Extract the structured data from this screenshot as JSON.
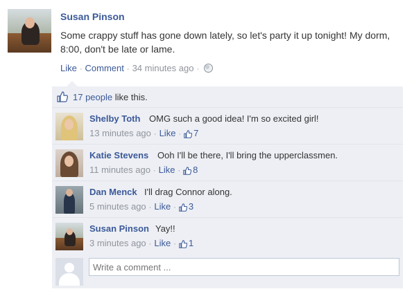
{
  "post": {
    "author": "Susan Pinson",
    "text": "Some crappy stuff has gone down lately, so let's party it up tonight! My dorm, 8:00, don't be late or lame.",
    "like_label": "Like",
    "comment_label": "Comment",
    "timestamp": "34 minutes ago",
    "privacy_icon": "globe-icon"
  },
  "likes": {
    "count_text": "17 people",
    "suffix": " like this.",
    "icon": "thumbs-up-icon"
  },
  "comments": [
    {
      "name": "Shelby Toth",
      "text": "OMG such a good idea! I'm so excited girl!",
      "time": "13 minutes ago",
      "like_label": "Like",
      "likes": "7"
    },
    {
      "name": "Katie Stevens",
      "text": "Ooh I'll be there, I'll bring the upperclassmen.",
      "time": "11 minutes ago",
      "like_label": "Like",
      "likes": "8"
    },
    {
      "name": "Dan Menck",
      "text": "I'll drag Connor along.",
      "time": "5 minutes ago",
      "like_label": "Like",
      "likes": "3"
    },
    {
      "name": "Susan Pinson",
      "text": "Yay!!",
      "time": "3 minutes ago",
      "like_label": "Like",
      "likes": "1"
    }
  ],
  "write_comment": {
    "placeholder": "Write a comment ..."
  },
  "colors": {
    "link": "#3b5998",
    "meta": "#90949c",
    "panel": "#edeff4"
  }
}
